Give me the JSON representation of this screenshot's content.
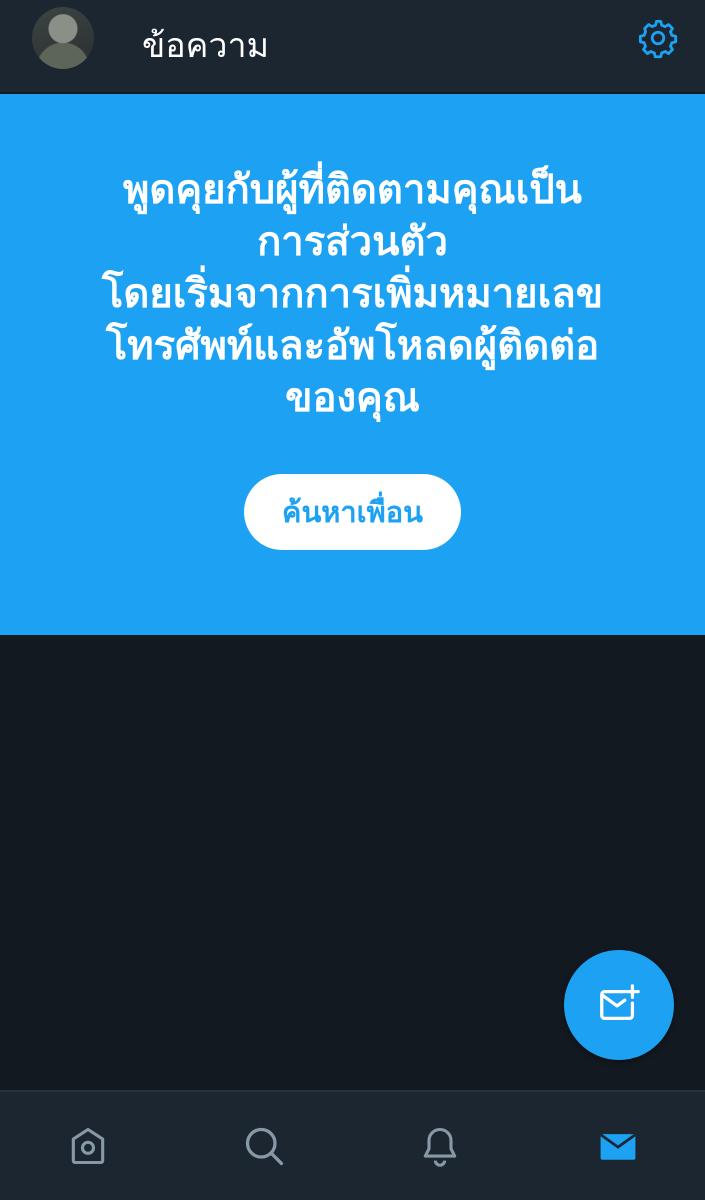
{
  "header": {
    "title": "ข้อความ",
    "avatar_icon": "profile-avatar",
    "settings_icon": "gear-icon"
  },
  "banner": {
    "lines": [
      "พูดคุยกับผู้ที่ติดตามคุณเป็น",
      "การส่วนตัว",
      "โดยเริ่มจากการเพิ่มหมายเลข",
      "โทรศัพท์และอัพโหลดผู้ติดต่อ",
      "ของคุณ"
    ],
    "button_label": "ค้นหาเพื่อน"
  },
  "fab": {
    "icon": "new-message-icon"
  },
  "bottom_nav": {
    "items": [
      {
        "name": "home",
        "icon": "home-icon"
      },
      {
        "name": "search",
        "icon": "search-icon"
      },
      {
        "name": "notifications",
        "icon": "bell-icon"
      },
      {
        "name": "messages",
        "icon": "mail-icon",
        "active": true
      }
    ]
  },
  "colors": {
    "accent": "#1da1f2",
    "header_bg": "#1b2631",
    "body_bg": "#121920",
    "nav_inactive": "#8899a6"
  }
}
